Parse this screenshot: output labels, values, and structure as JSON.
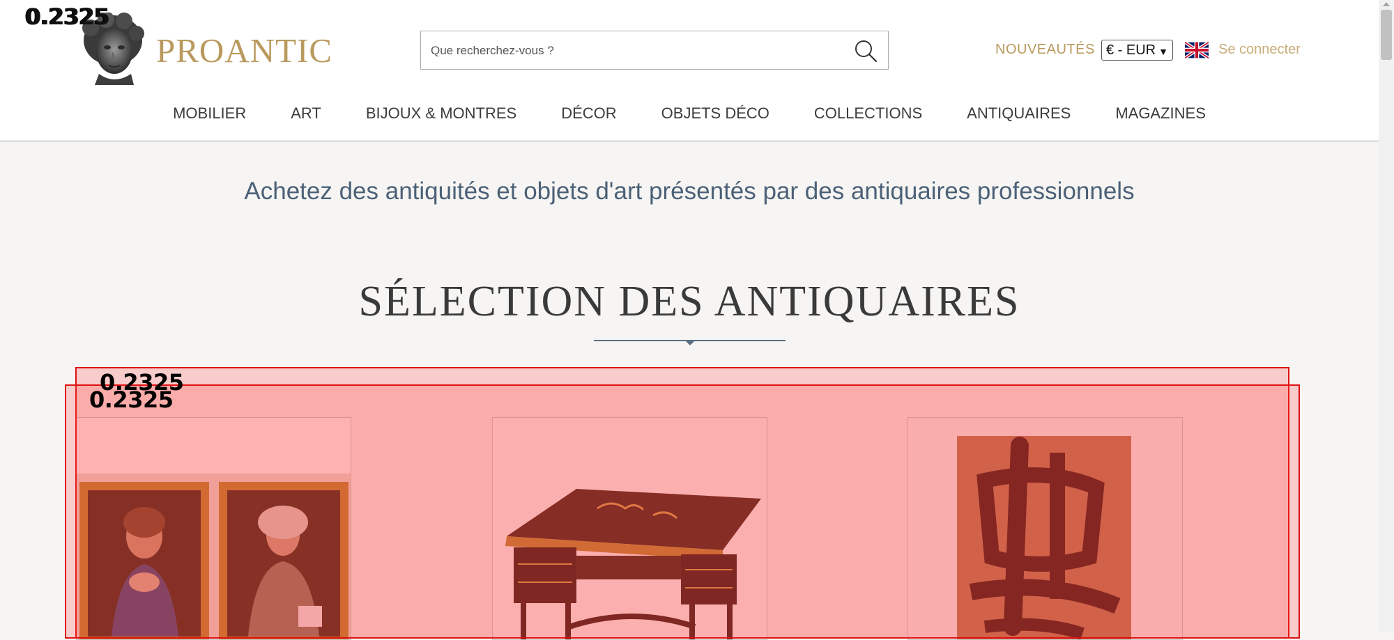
{
  "header": {
    "logo_text": "PROANTIC",
    "search": {
      "placeholder": "Que recherchez-vous ?",
      "value": ""
    },
    "nouveautes_label": "NOUVEAUTÉS",
    "currency": "€ - EUR",
    "language_flag": "uk-flag-icon",
    "login_label": "Se connecter"
  },
  "nav": {
    "items": [
      {
        "label": "MOBILIER"
      },
      {
        "label": "ART"
      },
      {
        "label": "BIJOUX & MONTRES"
      },
      {
        "label": "DÉCOR"
      },
      {
        "label": "OBJETS DÉCO"
      },
      {
        "label": "COLLECTIONS"
      },
      {
        "label": "ANTIQUAIRES"
      },
      {
        "label": "MAGAZINES"
      }
    ]
  },
  "main": {
    "tagline": "Achetez des antiquités et objets d'art présentés par des antiquaires professionnels",
    "section_title": "SÉLECTION DES ANTIQUAIRES",
    "cards": [
      {
        "image": "pair-of-portraits-image"
      },
      {
        "image": "lacquered-desk-image"
      },
      {
        "image": "calligraphy-painting-image"
      }
    ]
  },
  "overlays": {
    "corner_label_a": "0.2325",
    "corner_label_b": "0.2325",
    "box_a_label": "0.2325",
    "box_b_label": "0.2325"
  },
  "colors": {
    "brand_gold": "#b99a5e",
    "tagline_blue": "#4c6178",
    "overlay_red": "#e01010"
  }
}
